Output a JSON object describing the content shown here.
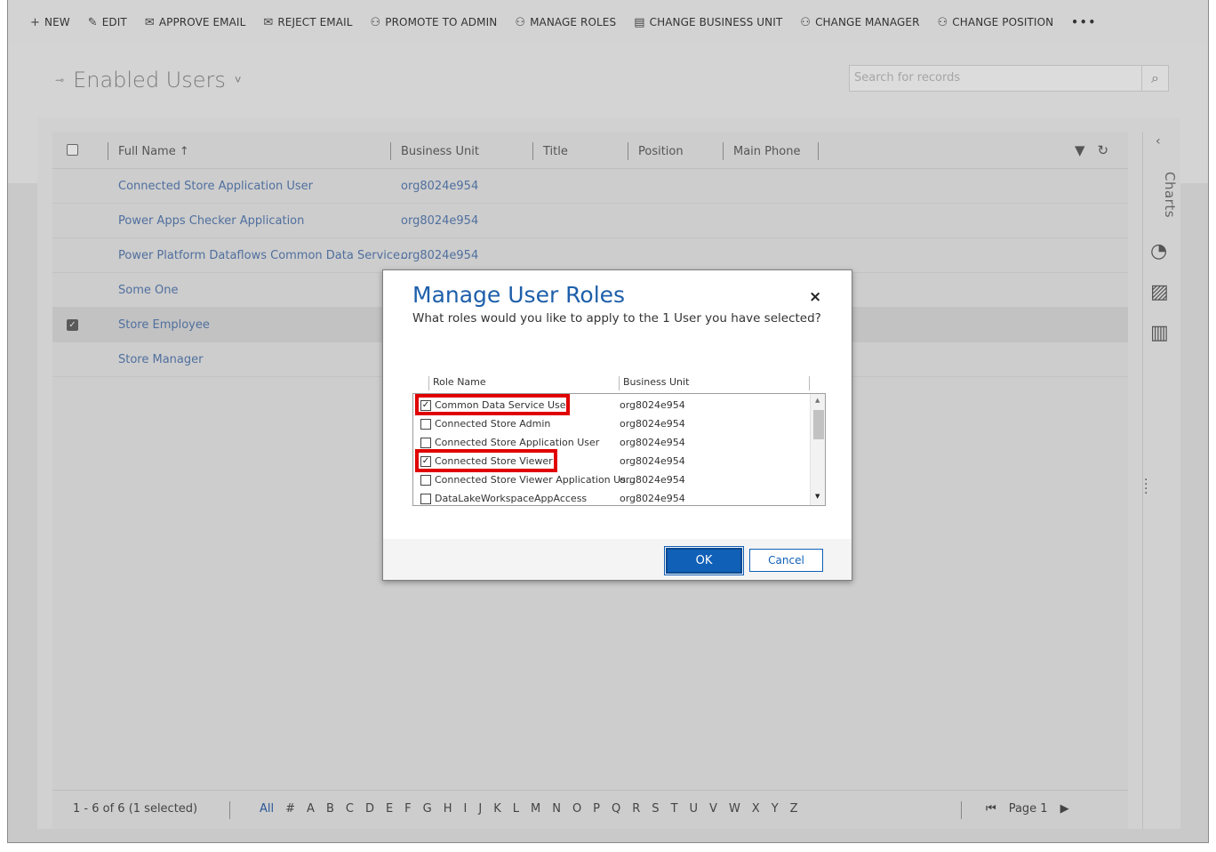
{
  "commandbar": {
    "items": [
      {
        "label": "NEW",
        "icon": "+"
      },
      {
        "label": "EDIT",
        "icon": "✎"
      },
      {
        "label": "APPROVE EMAIL",
        "icon": "✉"
      },
      {
        "label": "REJECT EMAIL",
        "icon": "✉"
      },
      {
        "label": "PROMOTE TO ADMIN",
        "icon": "⚇"
      },
      {
        "label": "MANAGE ROLES",
        "icon": "⚇"
      },
      {
        "label": "CHANGE BUSINESS UNIT",
        "icon": "▤"
      },
      {
        "label": "CHANGE MANAGER",
        "icon": "⚇"
      },
      {
        "label": "CHANGE POSITION",
        "icon": "⚇"
      }
    ],
    "more": "•••"
  },
  "view": {
    "title": "Enabled Users",
    "chevron": "˅",
    "pin": "⊸"
  },
  "search": {
    "placeholder": "Search for records",
    "icon": "⌕"
  },
  "grid": {
    "columns": [
      "Full Name ↑",
      "Business Unit",
      "Title",
      "Position",
      "Main Phone"
    ],
    "rows": [
      {
        "name": "Connected Store Application User",
        "business_unit": "org8024e954",
        "selected": false
      },
      {
        "name": "Power Apps Checker Application",
        "business_unit": "org8024e954",
        "selected": false
      },
      {
        "name": "Power Platform Dataflows Common Data Service...",
        "business_unit": "org8024e954",
        "selected": false
      },
      {
        "name": "Some One",
        "business_unit": "",
        "selected": false
      },
      {
        "name": "Store Employee",
        "business_unit": "",
        "selected": true
      },
      {
        "name": "Store Manager",
        "business_unit": "",
        "selected": false
      }
    ],
    "footer": {
      "count": "1 - 6 of 6 (1 selected)",
      "letters": [
        "All",
        "#",
        "A",
        "B",
        "C",
        "D",
        "E",
        "F",
        "G",
        "H",
        "I",
        "J",
        "K",
        "L",
        "M",
        "N",
        "O",
        "P",
        "Q",
        "R",
        "S",
        "T",
        "U",
        "V",
        "W",
        "X",
        "Y",
        "Z"
      ],
      "page": "Page 1"
    }
  },
  "charts": {
    "label": "Charts"
  },
  "dialog": {
    "title": "Manage User Roles",
    "subtitle": "What roles would you like to apply to the 1 User you have selected?",
    "columns": [
      "Role Name",
      "Business Unit"
    ],
    "roles": [
      {
        "name": "Common Data Service User",
        "business_unit": "org8024e954",
        "checked": true,
        "highlighted": true
      },
      {
        "name": "Connected Store Admin",
        "business_unit": "org8024e954",
        "checked": false,
        "highlighted": false
      },
      {
        "name": "Connected Store Application User",
        "business_unit": "org8024e954",
        "checked": false,
        "highlighted": false
      },
      {
        "name": "Connected Store Viewer",
        "business_unit": "org8024e954",
        "checked": true,
        "highlighted": true
      },
      {
        "name": "Connected Store Viewer Application Us...",
        "business_unit": "org8024e954",
        "checked": false,
        "highlighted": false
      },
      {
        "name": "DataLakeWorkspaceAppAccess",
        "business_unit": "org8024e954",
        "checked": false,
        "highlighted": false
      }
    ],
    "ok_label": "OK",
    "cancel_label": "Cancel",
    "close_icon": "×",
    "highlight_color": "#e00000"
  }
}
